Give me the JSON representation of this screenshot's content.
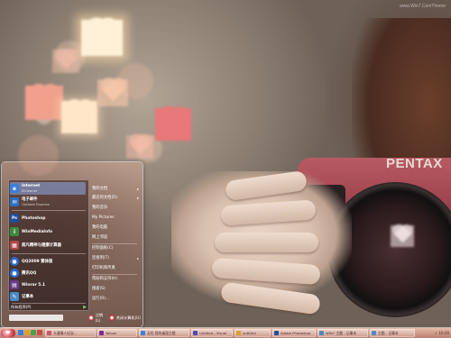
{
  "watermark": "www.Win7.ComTheme",
  "camera": {
    "brand": "PENTAX"
  },
  "start_menu": {
    "pinned": [
      {
        "title": "Internet",
        "subtitle": "IEcleaner",
        "icon": "internet-explorer-icon",
        "color": "#3a7fd8"
      },
      {
        "title": "电子邮件",
        "subtitle": "Outlook Express",
        "icon": "email-icon",
        "color": "#2d6fc0"
      }
    ],
    "recent": [
      {
        "title": "Photoshop",
        "icon": "photoshop-icon",
        "color": "#1f4f9a",
        "glyph": "Ps"
      },
      {
        "title": "WinMediaInfo",
        "icon": "media-info-icon",
        "color": "#3d8a3d"
      },
      {
        "title": "超凡精神与健康计算器",
        "icon": "calculator-app-icon",
        "color": "#b04848"
      },
      {
        "title": "QQ2009 繁体版",
        "icon": "qq-icon",
        "color": "#2a6ad0"
      },
      {
        "title": "腾讯QQ",
        "icon": "tencent-qq-icon",
        "color": "#2a70d6"
      },
      {
        "title": "Winrar 5.1",
        "icon": "winrar-icon",
        "color": "#6a3a90"
      },
      {
        "title": "记事本",
        "icon": "notepad-icon",
        "color": "#4a8ac8"
      }
    ],
    "all_programs": "所有程序(P)",
    "right_items": [
      {
        "label": "我的文档",
        "arrow": "▸"
      },
      {
        "label": "最近的文档(D)",
        "arrow": "▸"
      },
      {
        "label": "我的音乐",
        "arrow": ""
      },
      {
        "label": "My Pictures",
        "arrow": ""
      },
      {
        "label": "我的电脑",
        "arrow": ""
      },
      {
        "label": "网上邻居",
        "arrow": ""
      },
      {
        "label": "控制面板(C)",
        "arrow": ""
      },
      {
        "label": "连接到(T)",
        "arrow": "▸"
      },
      {
        "label": "打印机和传真",
        "arrow": ""
      },
      {
        "label": "帮助和支持(H)",
        "arrow": ""
      },
      {
        "label": "搜索(S)",
        "arrow": ""
      },
      {
        "label": "运行(R)...",
        "arrow": ""
      }
    ],
    "logoff": "注销(L)",
    "shutdown": "关闭计算机(U)"
  },
  "taskbar": {
    "start": "❤",
    "quick_launch_colors": [
      "#3a7fd8",
      "#d8a030",
      "#4aa04a",
      "#c84a4a"
    ],
    "buttons": [
      {
        "label": "卡通情人纪念...",
        "icon_color": "#c85a6a"
      },
      {
        "label": "Yahoo!",
        "icon_color": "#7a2a9a"
      },
      {
        "label": "无忧·我的桌面主题",
        "icon_color": "#3a7fd8"
      },
      {
        "label": "Untitled - Visual",
        "icon_color": "#4a4ab0"
      },
      {
        "label": "untitled",
        "icon_color": "#d8a030"
      },
      {
        "label": "Adobe Photoshop",
        "icon_color": "#1f4f9a"
      },
      {
        "label": "WIN7 主题 - 记事本",
        "icon_color": "#4a8ac8"
      },
      {
        "label": "主题 - 记事本",
        "icon_color": "#4a8ac8"
      }
    ],
    "clock": "10:26"
  }
}
